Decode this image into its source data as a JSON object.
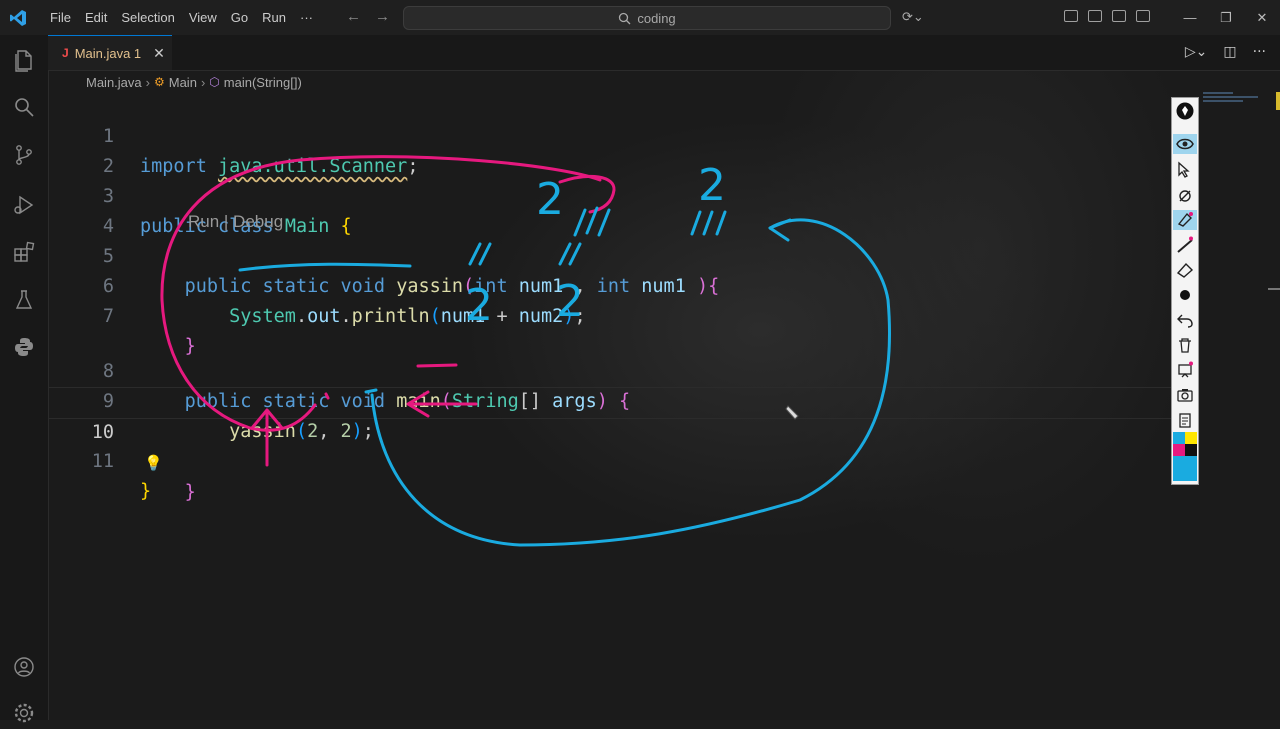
{
  "menu": {
    "items": [
      "File",
      "Edit",
      "Selection",
      "View",
      "Go",
      "Run",
      "···"
    ]
  },
  "search": {
    "text": "coding"
  },
  "tab": {
    "type_letter": "J",
    "name": "Main.java 1",
    "close": "✕"
  },
  "breadcrumb": {
    "file": "Main.java",
    "class": "Main",
    "method": "main(String[])"
  },
  "codelens": "Run | Debug",
  "lines": [
    {
      "n": "1"
    },
    {
      "n": "2"
    },
    {
      "n": "3"
    },
    {
      "n": "4"
    },
    {
      "n": "5"
    },
    {
      "n": "6"
    },
    {
      "n": "7"
    },
    {
      "n": "8"
    },
    {
      "n": "9"
    },
    {
      "n": "10"
    },
    {
      "n": "11"
    }
  ],
  "code": {
    "l1": {
      "import": "import",
      "pkg": "java.util.Scanner",
      "semi": ";"
    },
    "l3": {
      "public": "public",
      "class": "class",
      "name": "Main",
      "brace": "{"
    },
    "l5": {
      "public": "public",
      "static": "static",
      "void": "void",
      "fn": "yassin",
      "open": "(",
      "t1": "int",
      "p1": "num1",
      "comma": ",",
      "t2": "int",
      "p2": "num1",
      "close": ")",
      "brace": "{"
    },
    "l6": {
      "sys": "System",
      "dot1": ".",
      "out": "out",
      "dot2": ".",
      "fn": "println",
      "open": "(",
      "a": "num1",
      "plus": "+",
      "b": "num2",
      "close": ")",
      "semi": ";"
    },
    "l7": {
      "brace": "}"
    },
    "l8": {
      "public": "public",
      "static": "static",
      "void": "void",
      "fn": "main",
      "open": "(",
      "type": "String",
      "arr": "[]",
      "p": "args",
      "close": ")",
      "brace": "{"
    },
    "l9": {
      "fn": "yassin",
      "open": "(",
      "a": "2",
      "comma": ",",
      "b": "2",
      "close": ")",
      "semi": ";"
    },
    "l10": {
      "brace": "}"
    },
    "l11": {
      "brace": "}"
    }
  },
  "colors": {
    "ink_pink": "#e6197f",
    "ink_blue": "#1aabe0",
    "accent": "#0078d4"
  },
  "annotations": {
    "digits": [
      "2",
      "2",
      "2",
      "2",
      "2"
    ]
  }
}
